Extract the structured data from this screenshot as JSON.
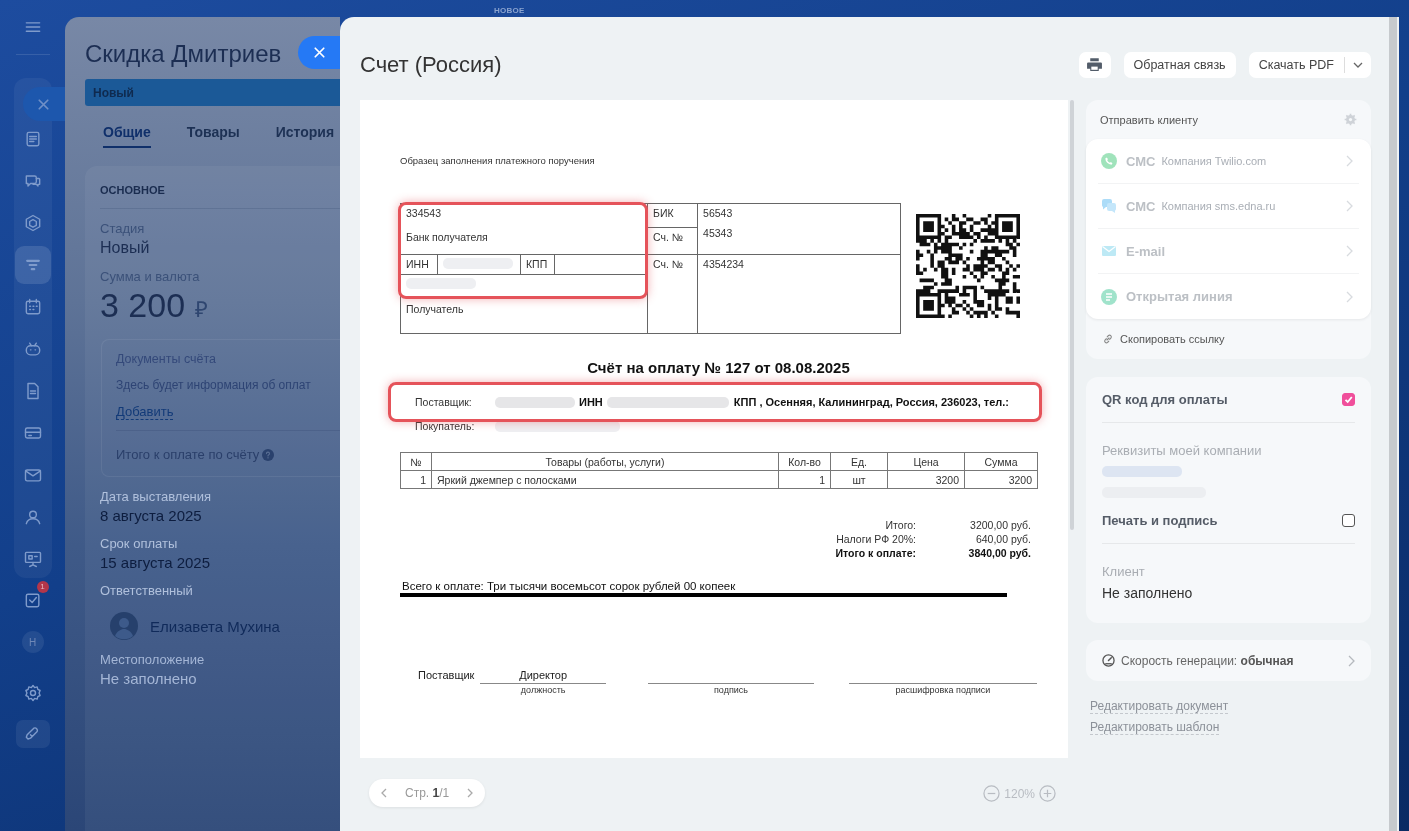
{
  "top_label": "НОВОЕ",
  "sidebar": {
    "top": [
      {
        "selected": false
      }
    ],
    "main": [
      {
        "selected": false
      },
      {
        "selected": false
      },
      {
        "selected": false
      },
      {
        "selected": true
      },
      {
        "selected": false
      },
      {
        "selected": false
      },
      {
        "selected": false
      },
      {
        "selected": false
      },
      {
        "selected": false
      },
      {
        "selected": false
      },
      {
        "selected": false
      }
    ],
    "bottom": [
      {
        "kind": "icon",
        "selected": false,
        "badge": "1"
      },
      {
        "kind": "avatar",
        "selected": false,
        "label": "Н"
      },
      {
        "kind": "icon",
        "selected": false
      },
      {
        "kind": "icon",
        "selected": false
      }
    ]
  },
  "back_panel": {
    "title": "Скидка Дмитриев",
    "stage": "Новый",
    "tabs": [
      {
        "label": "Общие",
        "selected": true
      },
      {
        "label": "Товары",
        "selected": false
      },
      {
        "label": "История",
        "selected": false
      }
    ],
    "section": "ОСНОВНОЕ",
    "stage_field": {
      "label": "Стадия",
      "value": "Новый"
    },
    "amount": {
      "label": "Сумма и валюта",
      "value": "3 200",
      "currency": "₽"
    },
    "documents": {
      "title": "Документы счёта",
      "text": "Здесь будет информация об оплат",
      "link": "Добавить",
      "total_label": "Итого к оплате по счёту"
    },
    "dates": [
      {
        "label": "Дата выставления",
        "value": "8 августа 2025"
      },
      {
        "label": "Срок оплаты",
        "value": "15 августа 2025"
      }
    ],
    "responsible": {
      "label": "Ответственный",
      "name": "Елизавета Мухина"
    },
    "location": {
      "label": "Местоположение",
      "value": "Не заполнено"
    }
  },
  "invoice": {
    "title": "Счет (Россия)",
    "feedback_button": "Обратная связь",
    "download_button": "Скачать PDF",
    "document": {
      "note": "Образец заполнения платежного поручения",
      "bank": {
        "bank_account": "334543",
        "bank_label": "Банк получателя",
        "inn_label": "ИНН",
        "kpp_label": "КПП",
        "recipient_label": "Получатель",
        "bik_label": "БИК",
        "bik": "56543",
        "corr_label": "Сч. №",
        "corr": "45343",
        "account_label": "Сч. №",
        "account": "4354234",
        "highlighted": true
      },
      "heading": "Счёт на оплату № 127 от 08.08.2025",
      "supplier": {
        "label": "Поставщик:",
        "inn_label": "ИНН",
        "rest": "КПП , Осенняя, Калининград, Россия, 236023, тел.:",
        "highlighted": true
      },
      "buyer": {
        "label": "Покупатель:"
      },
      "items_table": {
        "columns": [
          "№",
          "Товары (работы, услуги)",
          "Кол-во",
          "Ед.",
          "Цена",
          "Сумма"
        ],
        "rows": [
          [
            "1",
            "Яркий джемпер с полосками",
            "1",
            "шт",
            "3200",
            "3200"
          ]
        ]
      },
      "totals": [
        {
          "label": "Итого:",
          "value": "3200,00 руб.",
          "bold": false
        },
        {
          "label": "Налоги РФ 20%:",
          "value": "640,00 руб.",
          "bold": false
        },
        {
          "label": "Итого к оплате:",
          "value": "3840,00 руб.",
          "bold": true
        }
      ],
      "amount_in_words": "Всего к оплате: Три тысячи восемьсот сорок рублей 00 копеек",
      "signature": {
        "role_label": "Поставщик",
        "position": "Директор",
        "captions": [
          "должность",
          "подпись",
          "расшифровка подписи"
        ]
      }
    },
    "pager": {
      "label": "Стр. **1**/1"
    },
    "zoom": "120%",
    "send": {
      "title": "Отправить клиенту",
      "channels": [
        {
          "name": "СМС",
          "provider": "Компания Twilio.com",
          "disabled": true
        },
        {
          "name": "СМС",
          "provider": "Компания sms.edna.ru",
          "disabled": true
        },
        {
          "name": "E-mail",
          "disabled": true
        },
        {
          "name": "Открытая линия",
          "disabled": true
        }
      ],
      "copy_link": "Скопировать ссылку"
    },
    "settings": {
      "qr": {
        "label": "QR код для оплаты",
        "checked": true
      },
      "company_label": "Реквизиты моей компании",
      "stamp": {
        "label": "Печать и подпись",
        "checked": false
      },
      "client": {
        "label": "Клиент",
        "value": "Не заполнено"
      }
    },
    "speed": "Скорость генерации: **обычная**",
    "links": [
      "Редактировать документ",
      "Редактировать шаблон"
    ]
  }
}
